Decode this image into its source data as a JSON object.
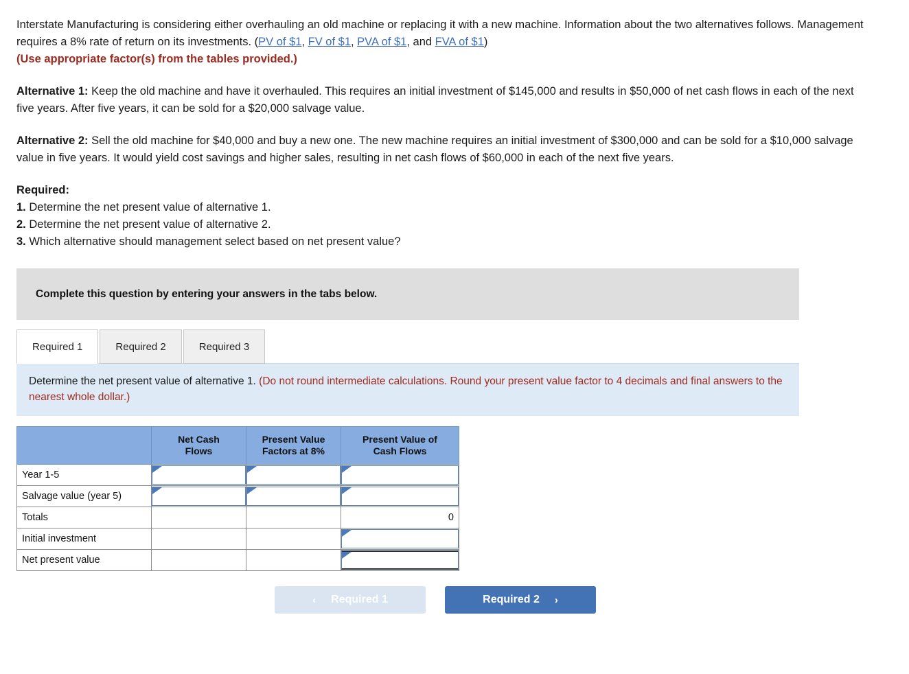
{
  "problem": {
    "intro_part1": "Interstate Manufacturing is considering either overhauling an old machine or replacing it with a new machine. Information about the two alternatives follows. Management requires a 8% rate of return on its investments. (",
    "links": [
      {
        "label": "PV of $1"
      },
      {
        "label": "FV of $1"
      },
      {
        "label": "PVA of $1"
      },
      {
        "label": "FVA of $1"
      }
    ],
    "link_sep1": ", ",
    "link_sep2": ", ",
    "link_sep3": ", and ",
    "intro_part2": ")",
    "use_factors_note": "(Use appropriate factor(s) from the tables provided.)",
    "alt1_label": "Alternative 1:",
    "alt1_text": " Keep the old machine and have it overhauled. This requires an initial investment of $145,000 and results in $50,000 of net cash flows in each of the next five years. After five years, it can be sold for a $20,000 salvage value.",
    "alt2_label": "Alternative 2:",
    "alt2_text": " Sell the old machine for $40,000 and buy a new one. The new machine requires an initial investment of $300,000 and can be sold for a $10,000 salvage value in five years. It would yield cost savings and higher sales, resulting in net cash flows of $60,000 in each of the next five years.",
    "required_heading": "Required:",
    "required_items": [
      {
        "num": "1.",
        "text": " Determine the net present value of alternative 1."
      },
      {
        "num": "2.",
        "text": " Determine the net present value of alternative 2."
      },
      {
        "num": "3.",
        "text": " Which alternative should management select based on net present value?"
      }
    ]
  },
  "banner": {
    "text": "Complete this question by entering your answers in the tabs below."
  },
  "tabs": [
    {
      "label": "Required 1",
      "active": true
    },
    {
      "label": "Required 2",
      "active": false
    },
    {
      "label": "Required 3",
      "active": false
    }
  ],
  "instruction": {
    "main": "Determine the net present value of alternative 1. ",
    "note": "(Do not round intermediate calculations. Round your present value factor to 4 decimals and final answers to the nearest whole dollar.)"
  },
  "table": {
    "headers": [
      "",
      "Net Cash Flows",
      "Present Value Factors at 8%",
      "Present Value of Cash Flows"
    ],
    "header_lines": {
      "col1_line1": "Net Cash",
      "col1_line2": "Flows",
      "col2_line1": "Present Value",
      "col2_line2": "Factors at 8%",
      "col3_line1": "Present Value of",
      "col3_line2": "Cash Flows"
    },
    "rows": [
      {
        "label": "Year 1-5",
        "net_cash_flows": "",
        "pv_factor": "",
        "pv_cash_flows": "",
        "type": "input"
      },
      {
        "label": "Salvage value (year 5)",
        "net_cash_flows": "",
        "pv_factor": "",
        "pv_cash_flows": "",
        "type": "input"
      },
      {
        "label": "Totals",
        "net_cash_flows": "",
        "pv_factor": "",
        "pv_cash_flows": "0",
        "type": "computed"
      },
      {
        "label": "Initial investment",
        "net_cash_flows": "",
        "pv_factor": "",
        "pv_cash_flows": "",
        "type": "input-last-only"
      },
      {
        "label": "Net present value",
        "net_cash_flows": "",
        "pv_factor": "",
        "pv_cash_flows": "",
        "type": "input-last-only-total"
      }
    ]
  },
  "nav": {
    "prev_label": "Required 1",
    "next_label": "Required 2",
    "prev_chevron": "‹",
    "next_chevron": "›"
  },
  "colors": {
    "header_blue": "#86ace0",
    "instruction_blue": "#deeaf6",
    "banner_gray": "#dedede",
    "accent_red": "#9e2b20",
    "link_blue": "#3f6fb5",
    "button_blue": "#4473b5",
    "button_disabled": "#dbe5f1"
  }
}
